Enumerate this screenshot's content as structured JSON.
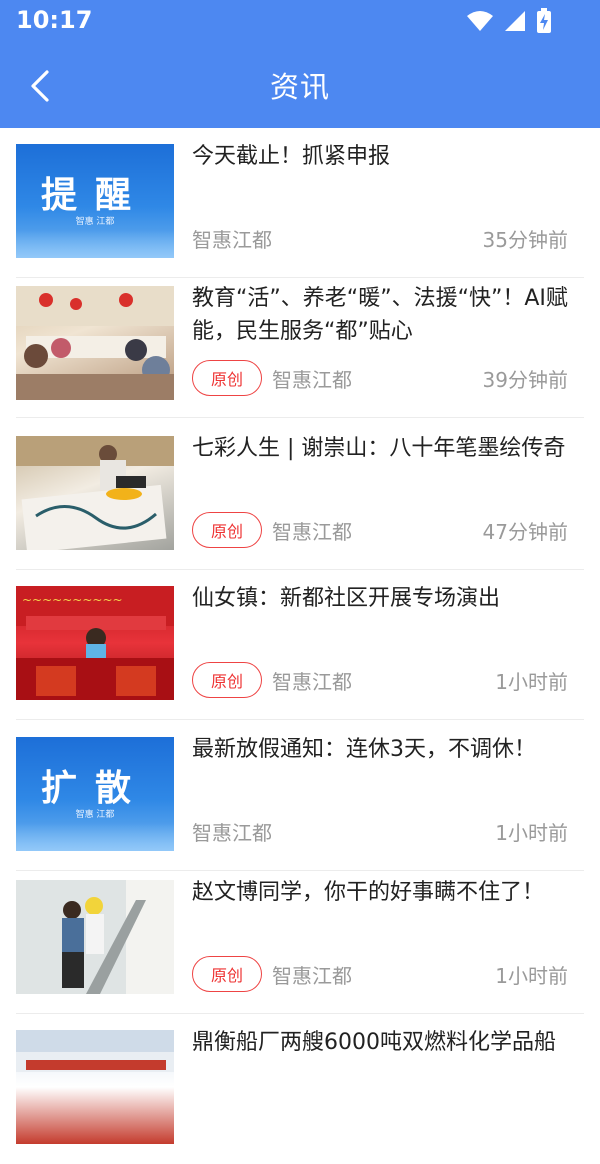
{
  "status_bar": {
    "time": "10:17"
  },
  "app_bar": {
    "title": "资讯"
  },
  "feed": [
    {
      "title": "今天截止！抓紧申报",
      "source": "智惠江都",
      "time": "35分钟前",
      "badge": "",
      "thumb_text": "提醒",
      "thumb_caption": "智惠 江都"
    },
    {
      "title": "教育“活”、养老“暖”、法援“快”！AI赋能，民生服务“都”贴心",
      "source": "智惠江都",
      "time": "39分钟前",
      "badge": "原创"
    },
    {
      "title": "七彩人生 | 谢崇山：八十年笔墨绘传奇",
      "source": "智惠江都",
      "time": "47分钟前",
      "badge": "原创"
    },
    {
      "title": "仙女镇：新都社区开展专场演出",
      "source": "智惠江都",
      "time": "1小时前",
      "badge": "原创"
    },
    {
      "title": "最新放假通知：连休3天，不调休！",
      "source": "智惠江都",
      "time": "1小时前",
      "badge": "",
      "thumb_text": "扩散",
      "thumb_caption": "智惠 江都"
    },
    {
      "title": "赵文博同学，你干的好事瞒不住了！",
      "source": "智惠江都",
      "time": "1小时前",
      "badge": "原创"
    },
    {
      "title": "鼎衡船厂两艘6000吨双燃料化学品船",
      "source": "",
      "time": "",
      "badge": ""
    }
  ],
  "colors": {
    "accent": "#4d88f1",
    "badge": "#e33333"
  }
}
